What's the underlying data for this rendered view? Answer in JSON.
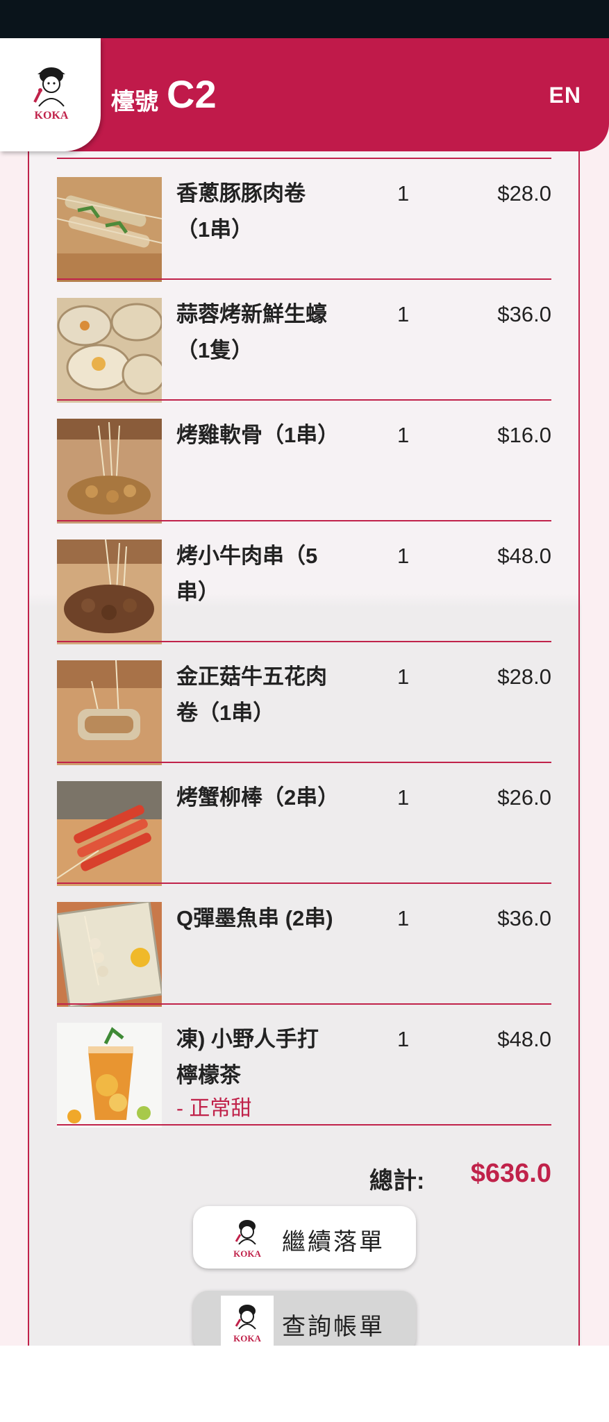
{
  "header": {
    "table_label": "檯號",
    "table_number": "C2",
    "language_toggle": "EN",
    "logo_text": "KOKA"
  },
  "order": {
    "items": [
      {
        "name_line1": "香蔥豚豚肉卷",
        "name_line2": "（1串）",
        "qty": "1",
        "price": "$28.0",
        "note": ""
      },
      {
        "name_line1": "蒜蓉烤新鮮生蠔",
        "name_line2": "（1隻）",
        "qty": "1",
        "price": "$36.0",
        "note": ""
      },
      {
        "name_line1": "烤雞軟骨（1串）",
        "name_line2": "",
        "qty": "1",
        "price": "$16.0",
        "note": ""
      },
      {
        "name_line1": "烤小牛肉串（5",
        "name_line2": "串）",
        "qty": "1",
        "price": "$48.0",
        "note": ""
      },
      {
        "name_line1": "金正菇牛五花肉",
        "name_line2": "卷（1串）",
        "qty": "1",
        "price": "$28.0",
        "note": ""
      },
      {
        "name_line1": "烤蟹柳棒（2串）",
        "name_line2": "",
        "qty": "1",
        "price": "$26.0",
        "note": ""
      },
      {
        "name_line1": "Q彈墨魚串 (2串)",
        "name_line2": "",
        "qty": "1",
        "price": "$36.0",
        "note": ""
      },
      {
        "name_line1": "凍) 小野人手打",
        "name_line2": "檸檬茶",
        "qty": "1",
        "price": "$48.0",
        "note": "- 正常甜"
      }
    ],
    "total_label": "總計:",
    "total_value": "$636.0"
  },
  "buttons": {
    "continue_order": "繼續落單",
    "view_bill": "查詢帳單"
  },
  "colors": {
    "brand": "#c01a4a",
    "status_bar": "#0a141b",
    "accent_text": "#c0224a"
  }
}
